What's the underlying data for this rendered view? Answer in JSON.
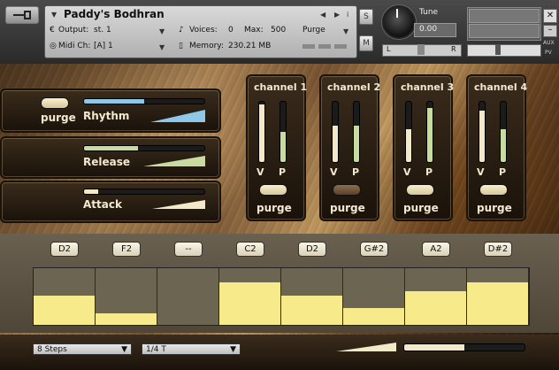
{
  "header": {
    "instrument_name": "Paddy's Bodhran",
    "output_label": "Output:",
    "output_value": "st. 1",
    "voices_label": "Voices:",
    "voices_value": "0",
    "max_label": "Max:",
    "max_value": "500",
    "purge_menu": "Purge",
    "midi_label": "Midi Ch:",
    "midi_value": "[A] 1",
    "memory_label": "Memory:",
    "memory_value": "230.21 MB",
    "solo_label": "S",
    "mute_label": "M",
    "tune_label": "Tune",
    "tune_value": "0.00",
    "pan_left": "L",
    "pan_right": "R",
    "aux_label": "AUX",
    "pv_label": "PV"
  },
  "left_controls": {
    "rhythm": {
      "label": "Rhythm",
      "purge_label": "purge",
      "purge_on": true,
      "value": 0.5
    },
    "release": {
      "label": "Release",
      "value": 0.45
    },
    "attack": {
      "label": "Attack",
      "value": 0.12
    }
  },
  "channels": [
    {
      "label": "channel 1",
      "v_label": "V",
      "p_label": "P",
      "v_level": 0.95,
      "p_level": 0.5,
      "purge_label": "purge",
      "purge_on": true
    },
    {
      "label": "channel 2",
      "v_label": "V",
      "p_label": "P",
      "v_level": 0.6,
      "p_level": 0.6,
      "purge_label": "purge",
      "purge_on": false
    },
    {
      "label": "channel 3",
      "v_label": "V",
      "p_label": "P",
      "v_level": 0.55,
      "p_level": 0.9,
      "purge_label": "purge",
      "purge_on": true
    },
    {
      "label": "channel 4",
      "v_label": "V",
      "p_label": "P",
      "v_level": 0.85,
      "p_level": 0.55,
      "purge_label": "purge",
      "purge_on": true
    }
  ],
  "steps": [
    {
      "note": "D2",
      "level": 0.52
    },
    {
      "note": "F2",
      "level": 0.21
    },
    {
      "note": "--",
      "level": 0.0
    },
    {
      "note": "C2",
      "level": 0.75
    },
    {
      "note": "D2",
      "level": 0.52
    },
    {
      "note": "G#2",
      "level": 0.29
    },
    {
      "note": "A2",
      "level": 0.6
    },
    {
      "note": "D#2",
      "level": 0.75
    }
  ],
  "footer": {
    "steps_select": "8 Steps",
    "rate_select": "1/4 T",
    "swing_value": 0.5
  },
  "colors": {
    "slider_blue": "#8ec8e8",
    "slider_green": "#c8dca0",
    "slider_cream": "#f3e9c8",
    "step_fill": "#f6ea8a"
  }
}
